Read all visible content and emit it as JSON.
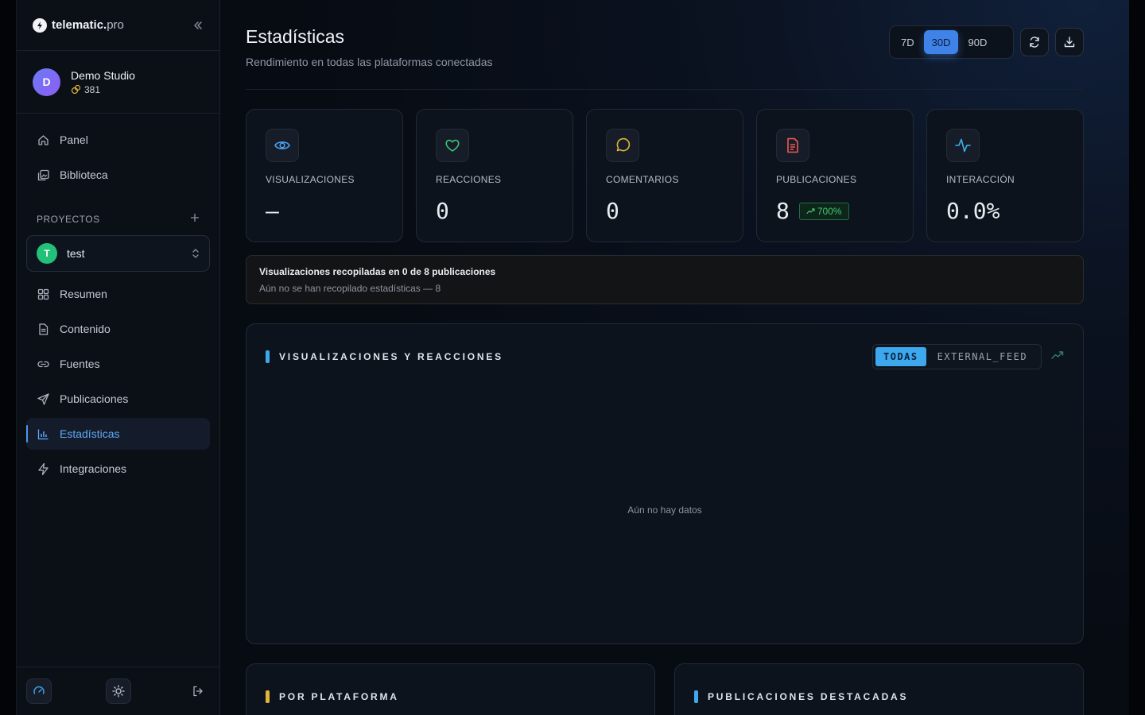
{
  "app": {
    "logo_bold": "telematic.",
    "logo_light": "pro"
  },
  "account": {
    "initial": "D",
    "name": "Demo Studio",
    "credits": "381"
  },
  "nav_top": [
    {
      "label": "Panel"
    },
    {
      "label": "Biblioteca"
    }
  ],
  "projects": {
    "section_label": "PROYECTOS",
    "selected": {
      "initial": "T",
      "name": "test"
    }
  },
  "nav_project": [
    {
      "label": "Resumen"
    },
    {
      "label": "Contenido"
    },
    {
      "label": "Fuentes"
    },
    {
      "label": "Publicaciones"
    },
    {
      "label": "Estadísticas"
    },
    {
      "label": "Integraciones"
    }
  ],
  "header": {
    "title": "Estadísticas",
    "subtitle": "Rendimiento en todas las plataformas conectadas",
    "ranges": [
      "7D",
      "30D",
      "90D"
    ],
    "active_range": "30D"
  },
  "stats": [
    {
      "label": "VISUALIZACIONES",
      "value": "—",
      "color": "#4aa3f0"
    },
    {
      "label": "REACCIONES",
      "value": "0",
      "color": "#3cc47a"
    },
    {
      "label": "COMENTARIOS",
      "value": "0",
      "color": "#e0b43a"
    },
    {
      "label": "PUBLICACIONES",
      "value": "8",
      "badge": "700%",
      "color": "#ee5a52"
    },
    {
      "label": "INTERACCIÓN",
      "value": "0.0%",
      "color": "#3fb0ee"
    }
  ],
  "notice": {
    "title": "Visualizaciones recopiladas en 0 de 8 publicaciones",
    "subtitle": "Aún no se han recopilado estadísticas — 8"
  },
  "chart_card": {
    "title": "VISUALIZACIONES Y REACCIONES",
    "filters": [
      "TODAS",
      "EXTERNAL_FEED"
    ],
    "active_filter": "TODAS",
    "empty": "Aún no hay datos",
    "accent": "#3ea8ef"
  },
  "bottom_cards": [
    {
      "title": "POR PLATAFORMA",
      "accent": "#e0b43a"
    },
    {
      "title": "PUBLICACIONES DESTACADAS",
      "accent": "#3ea8ef"
    }
  ]
}
